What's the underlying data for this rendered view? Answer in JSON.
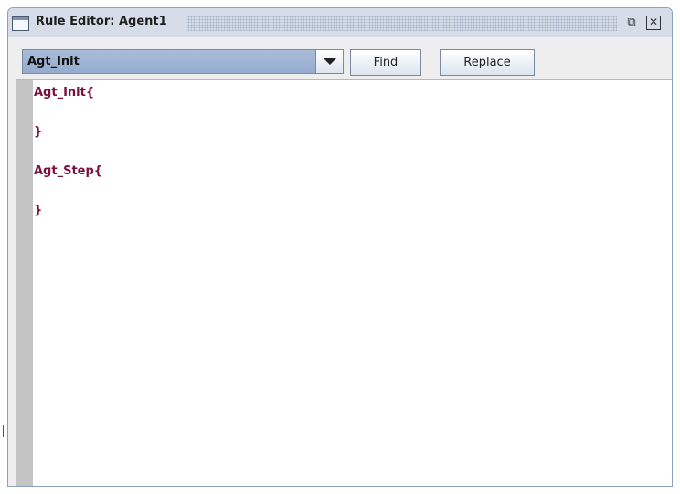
{
  "window": {
    "title": "Rule Editor: Agent1",
    "undock_glyph": "⧉",
    "close_glyph": "✕"
  },
  "toolbar": {
    "selector_value": "Agt_Init",
    "find_label": "Find",
    "replace_label": "Replace"
  },
  "editor": {
    "lines": [
      "Agt_Init{",
      "",
      "}",
      "",
      "Agt_Step{",
      "",
      "}"
    ]
  },
  "colors": {
    "code_text": "#7a1040",
    "selector_bg": "#a9bdd9",
    "gutter": "#c4c4c4"
  },
  "icons": {
    "window_icon": "window-icon",
    "undock_icon": "undock-icon",
    "close_icon": "close-icon",
    "dropdown_icon": "chevron-down-icon"
  }
}
